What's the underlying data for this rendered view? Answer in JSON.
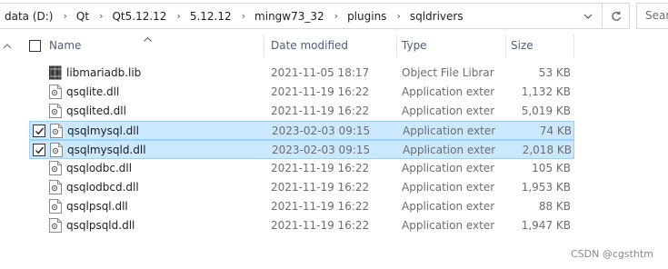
{
  "address_bar": {
    "crumbs": [
      "data (D:)",
      "Qt",
      "Qt5.12.12",
      "5.12.12",
      "mingw73_32",
      "plugins",
      "sqldrivers"
    ]
  },
  "search": {
    "placeholder": "Sear"
  },
  "columns": {
    "name": "Name",
    "date": "Date modified",
    "type": "Type",
    "size": "Size"
  },
  "files": [
    {
      "name": "libmariadb.lib",
      "date": "2021-11-05 18:17",
      "type": "Object File Library",
      "size": "53 KB",
      "icon": "library-file-icon",
      "selected": false
    },
    {
      "name": "qsqlite.dll",
      "date": "2021-11-19 16:22",
      "type": "Application exten...",
      "size": "1,132 KB",
      "icon": "dll-file-icon",
      "selected": false
    },
    {
      "name": "qsqlited.dll",
      "date": "2021-11-19 16:22",
      "type": "Application exten...",
      "size": "5,019 KB",
      "icon": "dll-file-icon",
      "selected": false
    },
    {
      "name": "qsqlmysql.dll",
      "date": "2023-02-03 09:15",
      "type": "Application exten...",
      "size": "74 KB",
      "icon": "dll-file-icon",
      "selected": true
    },
    {
      "name": "qsqlmysqld.dll",
      "date": "2023-02-03 09:15",
      "type": "Application exten...",
      "size": "2,018 KB",
      "icon": "dll-file-icon",
      "selected": true
    },
    {
      "name": "qsqlodbc.dll",
      "date": "2021-11-19 16:22",
      "type": "Application exten...",
      "size": "105 KB",
      "icon": "dll-file-icon",
      "selected": false
    },
    {
      "name": "qsqlodbcd.dll",
      "date": "2021-11-19 16:22",
      "type": "Application exten...",
      "size": "1,953 KB",
      "icon": "dll-file-icon",
      "selected": false
    },
    {
      "name": "qsqlpsql.dll",
      "date": "2021-11-19 16:22",
      "type": "Application exten...",
      "size": "88 KB",
      "icon": "dll-file-icon",
      "selected": false
    },
    {
      "name": "qsqlpsqld.dll",
      "date": "2021-11-19 16:22",
      "type": "Application exten...",
      "size": "1,947 KB",
      "icon": "dll-file-icon",
      "selected": false
    }
  ],
  "watermark": "CSDN @cgsthtm",
  "colors": {
    "selection_bg": "#cce8ff",
    "selection_border": "#99d1ff",
    "header_text": "#4c607a"
  }
}
